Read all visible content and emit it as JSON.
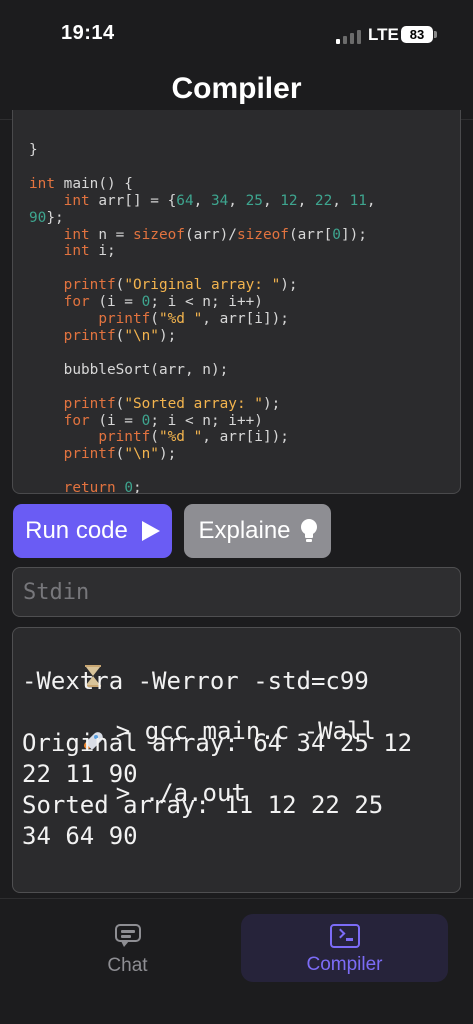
{
  "status_bar": {
    "time": "19:14",
    "network": "LTE",
    "battery": "83",
    "signal_bars_active": 1
  },
  "header": {
    "title": "Compiler"
  },
  "editor": {
    "language": "c",
    "lines": [
      [
        {
          "t": "pl",
          "v": "}"
        }
      ],
      [
        {
          "t": "pl",
          "v": ""
        }
      ],
      [
        {
          "t": "kw",
          "v": "int"
        },
        {
          "t": "pl",
          "v": " main() {"
        }
      ],
      [
        {
          "t": "pl",
          "v": "    "
        },
        {
          "t": "kw",
          "v": "int"
        },
        {
          "t": "pl",
          "v": " arr[] = {"
        },
        {
          "t": "num",
          "v": "64"
        },
        {
          "t": "pl",
          "v": ", "
        },
        {
          "t": "num",
          "v": "34"
        },
        {
          "t": "pl",
          "v": ", "
        },
        {
          "t": "num",
          "v": "25"
        },
        {
          "t": "pl",
          "v": ", "
        },
        {
          "t": "num",
          "v": "12"
        },
        {
          "t": "pl",
          "v": ", "
        },
        {
          "t": "num",
          "v": "22"
        },
        {
          "t": "pl",
          "v": ", "
        },
        {
          "t": "num",
          "v": "11"
        },
        {
          "t": "pl",
          "v": ","
        }
      ],
      [
        {
          "t": "num",
          "v": "90"
        },
        {
          "t": "pl",
          "v": "};"
        }
      ],
      [
        {
          "t": "pl",
          "v": "    "
        },
        {
          "t": "kw",
          "v": "int"
        },
        {
          "t": "pl",
          "v": " n = "
        },
        {
          "t": "kw",
          "v": "sizeof"
        },
        {
          "t": "pl",
          "v": "(arr)/"
        },
        {
          "t": "kw",
          "v": "sizeof"
        },
        {
          "t": "pl",
          "v": "(arr["
        },
        {
          "t": "num",
          "v": "0"
        },
        {
          "t": "pl",
          "v": "]);"
        }
      ],
      [
        {
          "t": "pl",
          "v": "    "
        },
        {
          "t": "kw",
          "v": "int"
        },
        {
          "t": "pl",
          "v": " i;"
        }
      ],
      [
        {
          "t": "pl",
          "v": ""
        }
      ],
      [
        {
          "t": "pl",
          "v": "    "
        },
        {
          "t": "kw",
          "v": "printf"
        },
        {
          "t": "pl",
          "v": "("
        },
        {
          "t": "str",
          "v": "\"Original array: \""
        },
        {
          "t": "pl",
          "v": ");"
        }
      ],
      [
        {
          "t": "pl",
          "v": "    "
        },
        {
          "t": "kw",
          "v": "for"
        },
        {
          "t": "pl",
          "v": " (i = "
        },
        {
          "t": "num",
          "v": "0"
        },
        {
          "t": "pl",
          "v": "; i < n; i++)"
        }
      ],
      [
        {
          "t": "pl",
          "v": "        "
        },
        {
          "t": "kw",
          "v": "printf"
        },
        {
          "t": "pl",
          "v": "("
        },
        {
          "t": "str",
          "v": "\"%d \""
        },
        {
          "t": "pl",
          "v": ", arr[i]);"
        }
      ],
      [
        {
          "t": "pl",
          "v": "    "
        },
        {
          "t": "kw",
          "v": "printf"
        },
        {
          "t": "pl",
          "v": "("
        },
        {
          "t": "str",
          "v": "\"\\n\""
        },
        {
          "t": "pl",
          "v": ");"
        }
      ],
      [
        {
          "t": "pl",
          "v": ""
        }
      ],
      [
        {
          "t": "pl",
          "v": "    bubbleSort(arr, n);"
        }
      ],
      [
        {
          "t": "pl",
          "v": ""
        }
      ],
      [
        {
          "t": "pl",
          "v": "    "
        },
        {
          "t": "kw",
          "v": "printf"
        },
        {
          "t": "pl",
          "v": "("
        },
        {
          "t": "str",
          "v": "\"Sorted array: \""
        },
        {
          "t": "pl",
          "v": ");"
        }
      ],
      [
        {
          "t": "pl",
          "v": "    "
        },
        {
          "t": "kw",
          "v": "for"
        },
        {
          "t": "pl",
          "v": " (i = "
        },
        {
          "t": "num",
          "v": "0"
        },
        {
          "t": "pl",
          "v": "; i < n; i++)"
        }
      ],
      [
        {
          "t": "pl",
          "v": "        "
        },
        {
          "t": "kw",
          "v": "printf"
        },
        {
          "t": "pl",
          "v": "("
        },
        {
          "t": "str",
          "v": "\"%d \""
        },
        {
          "t": "pl",
          "v": ", arr[i]);"
        }
      ],
      [
        {
          "t": "pl",
          "v": "    "
        },
        {
          "t": "kw",
          "v": "printf"
        },
        {
          "t": "pl",
          "v": "("
        },
        {
          "t": "str",
          "v": "\"\\n\""
        },
        {
          "t": "pl",
          "v": ");"
        }
      ],
      [
        {
          "t": "pl",
          "v": ""
        }
      ],
      [
        {
          "t": "pl",
          "v": "    "
        },
        {
          "t": "kw",
          "v": "return"
        },
        {
          "t": "pl",
          "v": " "
        },
        {
          "t": "num",
          "v": "0"
        },
        {
          "t": "pl",
          "v": ";"
        }
      ],
      [
        {
          "t": "pl",
          "v": "}"
        }
      ]
    ]
  },
  "actions": {
    "run_label": "Run code",
    "explain_label": "Explaine"
  },
  "stdin": {
    "placeholder": "Stdin",
    "value": ""
  },
  "console": {
    "compile_line_1": "> gcc main.c -Wall",
    "compile_line_2": "-Wextra -Werror -std=c99",
    "run_line": "> ./a.out",
    "output_line_1": "Original array: 64 34 25 12",
    "output_line_2": "22 11 90",
    "output_line_3": "Sorted array: 11 12 22 25",
    "output_line_4": "34 64 90"
  },
  "tabs": {
    "chat_label": "Chat",
    "compiler_label": "Compiler",
    "active": "compiler"
  },
  "colors": {
    "accent": "#6a5cf4",
    "active_tab": "#7c6cf6",
    "keyword": "#e2733f",
    "number": "#3ea58f",
    "string": "#f3b44e",
    "background": "#1c1c1e"
  }
}
